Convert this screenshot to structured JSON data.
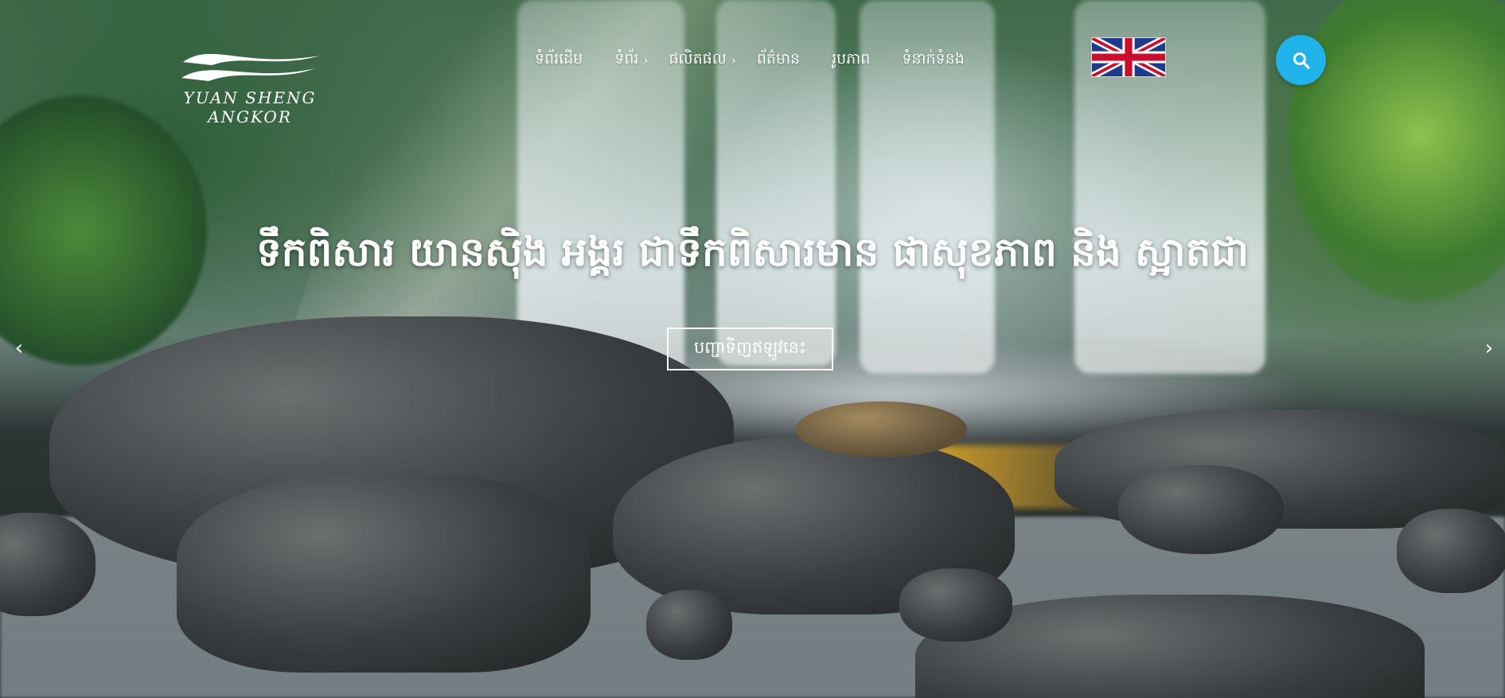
{
  "brand": {
    "logo_line1": "YUAN SHENG",
    "logo_line2": "ANGKOR"
  },
  "nav": {
    "items": [
      {
        "label": "ទំព័រដើម"
      },
      {
        "label": "ទំព័រ"
      },
      {
        "label": "ផលិតផល"
      },
      {
        "label": "ព័ត៌មាន"
      },
      {
        "label": "រូបភាព"
      },
      {
        "label": "ទំនាក់ទំនង"
      }
    ],
    "submenu_chevron": "›",
    "language_flag": "uk-flag-icon"
  },
  "search": {
    "icon": "search-icon",
    "button_color": "#1fb3ea"
  },
  "hero": {
    "headline": "ទឹកពិសារ យានស៊ិង អង្គរ ជាទឹកពិសារមាន ផាសុខភាព និង ស្អាតជា",
    "cta_label": "បញ្ជាទិញឥឡូវនេះ",
    "prev_arrow": "‹",
    "next_arrow": "›"
  }
}
